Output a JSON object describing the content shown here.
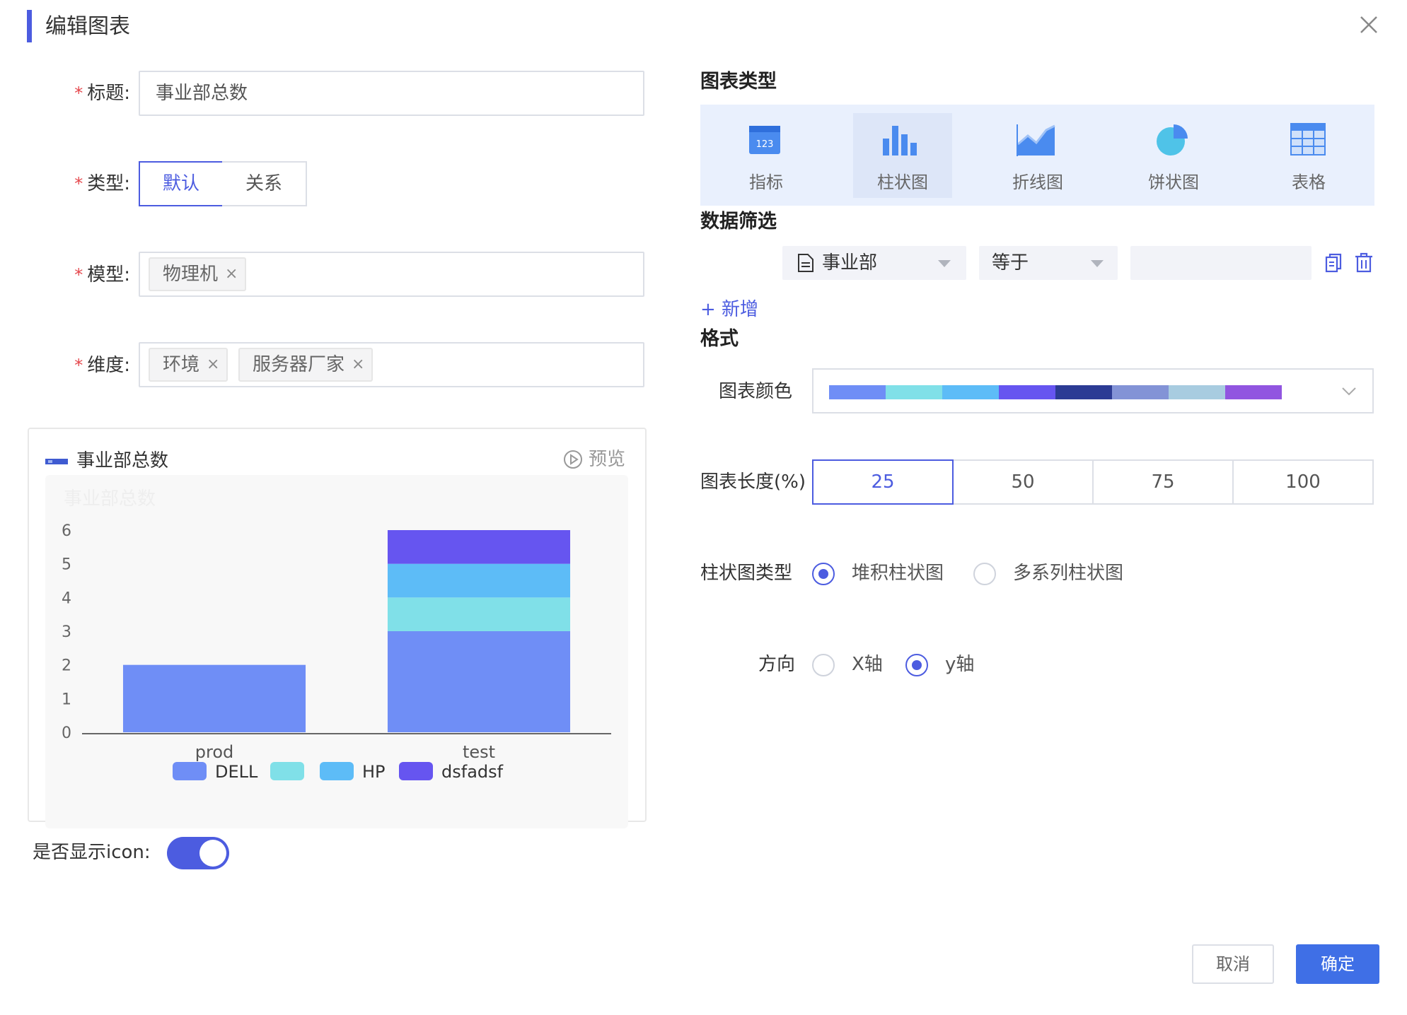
{
  "dialog": {
    "title": "编辑图表"
  },
  "form": {
    "title_label": "标题:",
    "title_value": "事业部总数",
    "type_label": "类型:",
    "type_options": [
      "默认",
      "关系"
    ],
    "model_label": "模型:",
    "model_tags": [
      "物理机"
    ],
    "dimension_label": "维度:",
    "dimension_tags": [
      "环境",
      "服务器厂家"
    ],
    "tag_close": "×",
    "required_mark": "*"
  },
  "preview": {
    "title": "事业部总数",
    "ghost_title": "事业部总数",
    "preview_label": "预览",
    "show_icon_label": "是否显示icon:",
    "show_icon_on": true
  },
  "chart_data": {
    "type": "bar",
    "stacked": true,
    "categories": [
      "prod",
      "test"
    ],
    "series": [
      {
        "name": "DELL",
        "values": [
          2,
          3
        ],
        "color": "#6f8ef6"
      },
      {
        "name": "",
        "values": [
          0,
          1
        ],
        "color": "#80e0e8"
      },
      {
        "name": "HP",
        "values": [
          0,
          1
        ],
        "color": "#5dbcf7"
      },
      {
        "name": "dsfadsf",
        "values": [
          0,
          1
        ],
        "color": "#6655f0"
      }
    ],
    "ylim": [
      0,
      6
    ],
    "yticks": [
      "0",
      "1",
      "2",
      "3",
      "4",
      "5",
      "6"
    ],
    "legend_position": "bottom",
    "grid": false
  },
  "right": {
    "chart_type_title": "图表类型",
    "chart_types": [
      {
        "label": "指标",
        "icon": "metric-icon"
      },
      {
        "label": "柱状图",
        "icon": "bar-chart-icon"
      },
      {
        "label": "折线图",
        "icon": "line-chart-icon"
      },
      {
        "label": "饼状图",
        "icon": "pie-chart-icon"
      },
      {
        "label": "表格",
        "icon": "table-icon"
      }
    ],
    "selected_type": "柱状图",
    "filter_title": "数据筛选",
    "filter": {
      "field": "事业部",
      "operator": "等于",
      "value": ""
    },
    "add_label": "+ 新增",
    "format_title": "格式",
    "color_label": "图表颜色",
    "palette": [
      "#6f8ef6",
      "#80e0e8",
      "#5dbcf7",
      "#6655f0",
      "#2c3b94",
      "#8393d6",
      "#a8cce0",
      "#9155e0"
    ],
    "length_label": "图表长度(%)",
    "length_options": [
      "25",
      "50",
      "75",
      "100"
    ],
    "length_selected": "25",
    "bar_type_label": "柱状图类型",
    "bar_type_options": [
      "堆积柱状图",
      "多系列柱状图"
    ],
    "bar_type_selected": "堆积柱状图",
    "direction_label": "方向",
    "direction_options": [
      "X轴",
      "y轴"
    ],
    "direction_selected": "y轴"
  },
  "footer": {
    "cancel": "取消",
    "ok": "确定"
  }
}
